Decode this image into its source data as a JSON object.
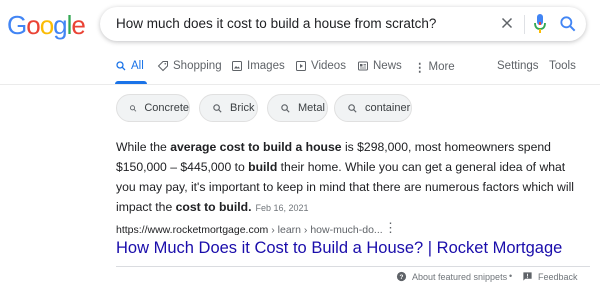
{
  "logo": {
    "letters": [
      "G",
      "o",
      "o",
      "g",
      "l",
      "e"
    ],
    "colors": [
      "#4285f4",
      "#ea4335",
      "#fbbc05",
      "#4285f4",
      "#34a853",
      "#ea4335"
    ]
  },
  "search": {
    "query": "How much does it cost to build a house from scratch?"
  },
  "tabs": [
    {
      "label": "All",
      "icon": "search-icon"
    },
    {
      "label": "Shopping",
      "icon": "tag-icon"
    },
    {
      "label": "Images",
      "icon": "image-icon"
    },
    {
      "label": "Videos",
      "icon": "video-icon"
    },
    {
      "label": "News",
      "icon": "newspaper-icon"
    },
    {
      "label": "More",
      "icon": "more-vertical-icon"
    }
  ],
  "tools": {
    "settings": "Settings",
    "tools": "Tools"
  },
  "chips": [
    "Concrete",
    "Brick",
    "Metal",
    "container"
  ],
  "snippet": {
    "t1": "While the ",
    "b1": "average cost to build a house",
    "t2": " is $298,000, most homeowners spend $150,000 – $445,000 to ",
    "b2": "build",
    "t3": " their home. While you can get a general idea of what you may pay, it's important to keep in mind that there are numerous factors which will impact the ",
    "b3": "cost to build.",
    "date": "Feb 16, 2021"
  },
  "result": {
    "url_base": "https://www.rocketmortgage.com",
    "url_path": " › learn › how-much-do...",
    "title": "How Much Does it Cost to Build a House? | Rocket Mortgage"
  },
  "footer": {
    "about": "About featured snippets",
    "bullet": "•",
    "feedback": "Feedback"
  },
  "accent_color": "#1a73e8",
  "link_color": "#1a0dab"
}
